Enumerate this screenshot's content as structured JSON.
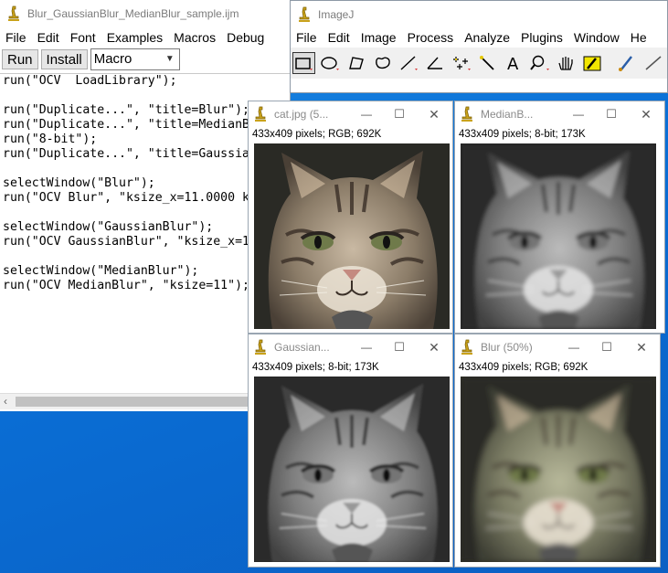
{
  "macro_window": {
    "title": "Blur_GaussianBlur_MedianBlur_sample.ijm",
    "menu": [
      "File",
      "Edit",
      "Font",
      "Examples",
      "Macros",
      "Debug"
    ],
    "run_label": "Run",
    "install_label": "Install",
    "language_selected": "Macro",
    "code_lines": [
      "run(\"OCV  LoadLibrary\");",
      "",
      "run(\"Duplicate...\", \"title=Blur\");",
      "run(\"Duplicate...\", \"title=MedianB",
      "run(\"8-bit\");",
      "run(\"Duplicate...\", \"title=Gaussia",
      "",
      "selectWindow(\"Blur\");",
      "run(\"OCV Blur\", \"ksize_x=11.0000 k",
      "",
      "selectWindow(\"GaussianBlur\");",
      "run(\"OCV GaussianBlur\", \"ksize_x=1",
      "",
      "selectWindow(\"MedianBlur\");",
      "run(\"OCV MedianBlur\", \"ksize=11\");"
    ]
  },
  "imagej_window": {
    "title": "ImageJ",
    "menu": [
      "File",
      "Edit",
      "Image",
      "Process",
      "Analyze",
      "Plugins",
      "Window",
      "He"
    ],
    "tools": [
      "rectangle-tool",
      "oval-tool",
      "polygon-tool",
      "freehand-tool",
      "line-tool",
      "angle-tool",
      "multipoint-tool",
      "wand-tool",
      "text-tool",
      "magnifier-tool",
      "hand-tool",
      "color-picker-tool",
      "brush-tool",
      "pencil-tool"
    ]
  },
  "image_windows": [
    {
      "id": "cat",
      "title": "cat.jpg (5...",
      "info": "433x409 pixels; RGB; 692K",
      "mode": "color",
      "blur": 0
    },
    {
      "id": "median",
      "title": "MedianB...",
      "info": "433x409 pixels; 8-bit; 173K",
      "mode": "gray",
      "blur": 2
    },
    {
      "id": "gaussian",
      "title": "Gaussian...",
      "info": "433x409 pixels; 8-bit; 173K",
      "mode": "gray",
      "blur": 1
    },
    {
      "id": "blur",
      "title": "Blur (50%)",
      "info": "433x409 pixels; RGB; 692K",
      "mode": "color",
      "blur": 3
    }
  ],
  "window_controls": {
    "minimize": "—",
    "maximize": "☐",
    "close": "✕"
  },
  "colors": {
    "desktop": "#0b6fd6",
    "accent_red": "#d83b3b",
    "editor_bg": "#ffffff"
  }
}
